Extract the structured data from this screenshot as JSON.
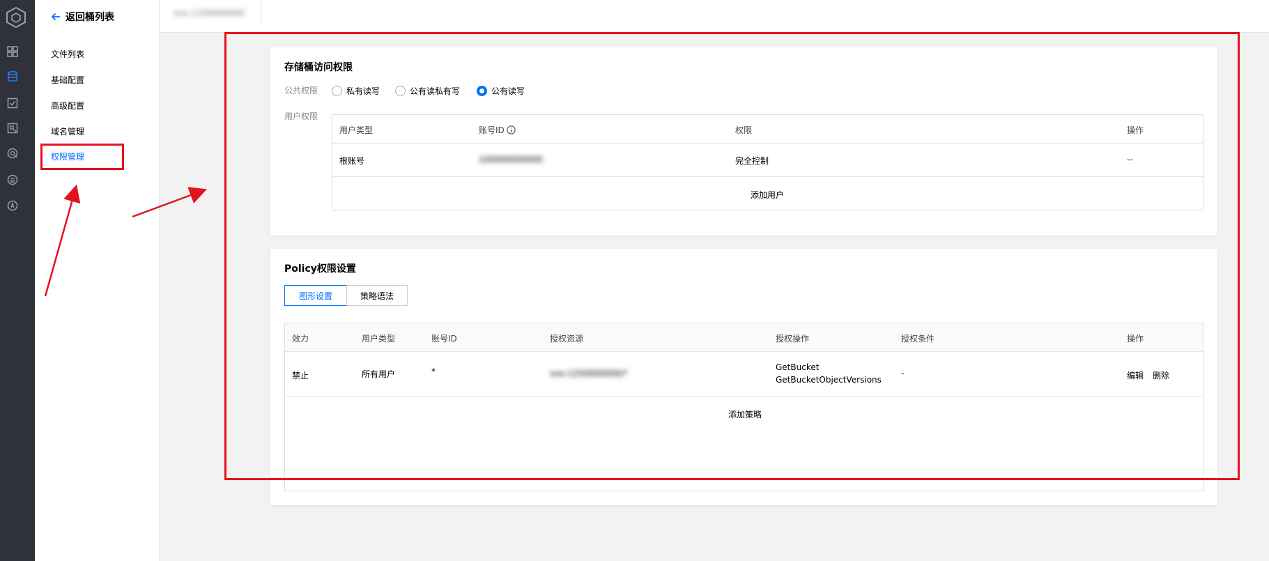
{
  "rail": {
    "icons": [
      "cube-logo-icon",
      "dashboard-icon",
      "bucket-icon",
      "task-icon",
      "image-icon",
      "monitor-icon",
      "menu-icon",
      "data-icon"
    ]
  },
  "subnav": {
    "back_label": "返回桶列表",
    "items": [
      "文件列表",
      "基础配置",
      "高级配置",
      "域名管理",
      "权限管理"
    ],
    "active_index": 4
  },
  "topbar": {
    "bucket_tab": "xxx-1250000000"
  },
  "bucket_acl": {
    "title": "存储桶访问权限",
    "public_label": "公共权限",
    "options": [
      "私有读写",
      "公有读私有写",
      "公有读写"
    ],
    "selected_index": 2,
    "user_label": "用户权限",
    "table": {
      "headers": [
        "用户类型",
        "账号ID",
        "权限",
        "操作"
      ],
      "rows": [
        {
          "type": "根账号",
          "account_id": "100000000000",
          "permission": "完全控制",
          "action": "--"
        }
      ],
      "add_link": "添加用户"
    }
  },
  "policy": {
    "title": "Policy权限设置",
    "tabs": [
      "图形设置",
      "策略语法"
    ],
    "active_tab": 0,
    "table": {
      "headers": [
        "效力",
        "用户类型",
        "账号ID",
        "授权资源",
        "授权操作",
        "授权条件",
        "操作"
      ],
      "rows": [
        {
          "effect": "禁止",
          "user_type": "所有用户",
          "account_id": "*",
          "resource": "xxx-1250000000/*",
          "action_1": "GetBucket",
          "action_2": "GetBucketObjectVersions",
          "condition": "-",
          "edit": "编辑",
          "delete": "删除"
        }
      ],
      "add_link": "添加策略"
    }
  },
  "colors": {
    "accent": "#006eff",
    "annotation": "#e3131d",
    "rail": "#2f3238"
  }
}
